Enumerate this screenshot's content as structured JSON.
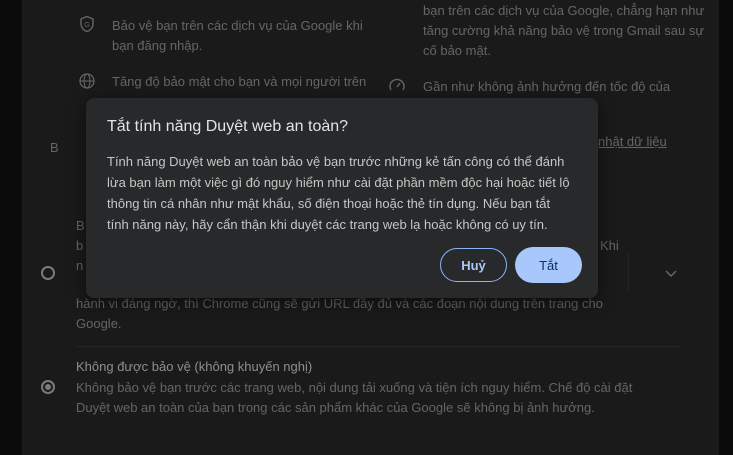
{
  "background": {
    "left_items": [
      {
        "icon": "google-shield-icon",
        "text": "Bảo vệ bạn trên các dịch vụ của Google khi bạn đăng nhập."
      },
      {
        "icon": "globe-icon",
        "text": "Tăng độ bảo mật cho bạn và mọi người trên"
      }
    ],
    "right_items": [
      {
        "text": "bạn trên các dịch vụ của Google, chẳng hạn như tăng cường khả năng bảo vệ trong Gmail sau sự cố bảo mật."
      },
      {
        "icon": "speed-gauge-icon",
        "text": "Gần như không ảnh hưởng đến tốc độ của"
      }
    ],
    "right_link": "nhật dữ liệu",
    "partial_left_letters": [
      "B",
      "B",
      "b",
      "n"
    ],
    "partial_right_text": "Khi",
    "standard_option_tail": "hành vi đáng ngờ, thì Chrome cũng sẽ gửi URL đầy đủ và các đoạn nội dung trên trang cho Google.",
    "no_protection": {
      "title": "Không được bảo vệ (không khuyến nghị)",
      "description": "Không bảo vệ bạn trước các trang web, nội dung tải xuống và tiện ích nguy hiểm. Chế độ cài đặt Duyệt web an toàn của bạn trong các sản phẩm khác của Google sẽ không bị ảnh hưởng."
    }
  },
  "dialog": {
    "title": "Tắt tính năng Duyệt web an toàn?",
    "body": "Tính năng Duyệt web an toàn bảo vệ bạn trước những kẻ tấn công có thể đánh lừa bạn làm một việc gì đó nguy hiểm như cài đặt phần mềm độc hại hoặc tiết lộ thông tin cá nhân như mật khẩu, số điện thoại hoặc thẻ tín dụng. Nếu bạn tắt tính năng này, hãy cẩn thận khi duyệt các trang web lạ hoặc không có uy tín.",
    "cancel_label": "Huỷ",
    "confirm_label": "Tắt"
  },
  "colors": {
    "page_bg": "#131314",
    "panel_bg": "#2a2a2b",
    "dialog_bg": "#28292b",
    "accent": "#a8c7fa"
  }
}
